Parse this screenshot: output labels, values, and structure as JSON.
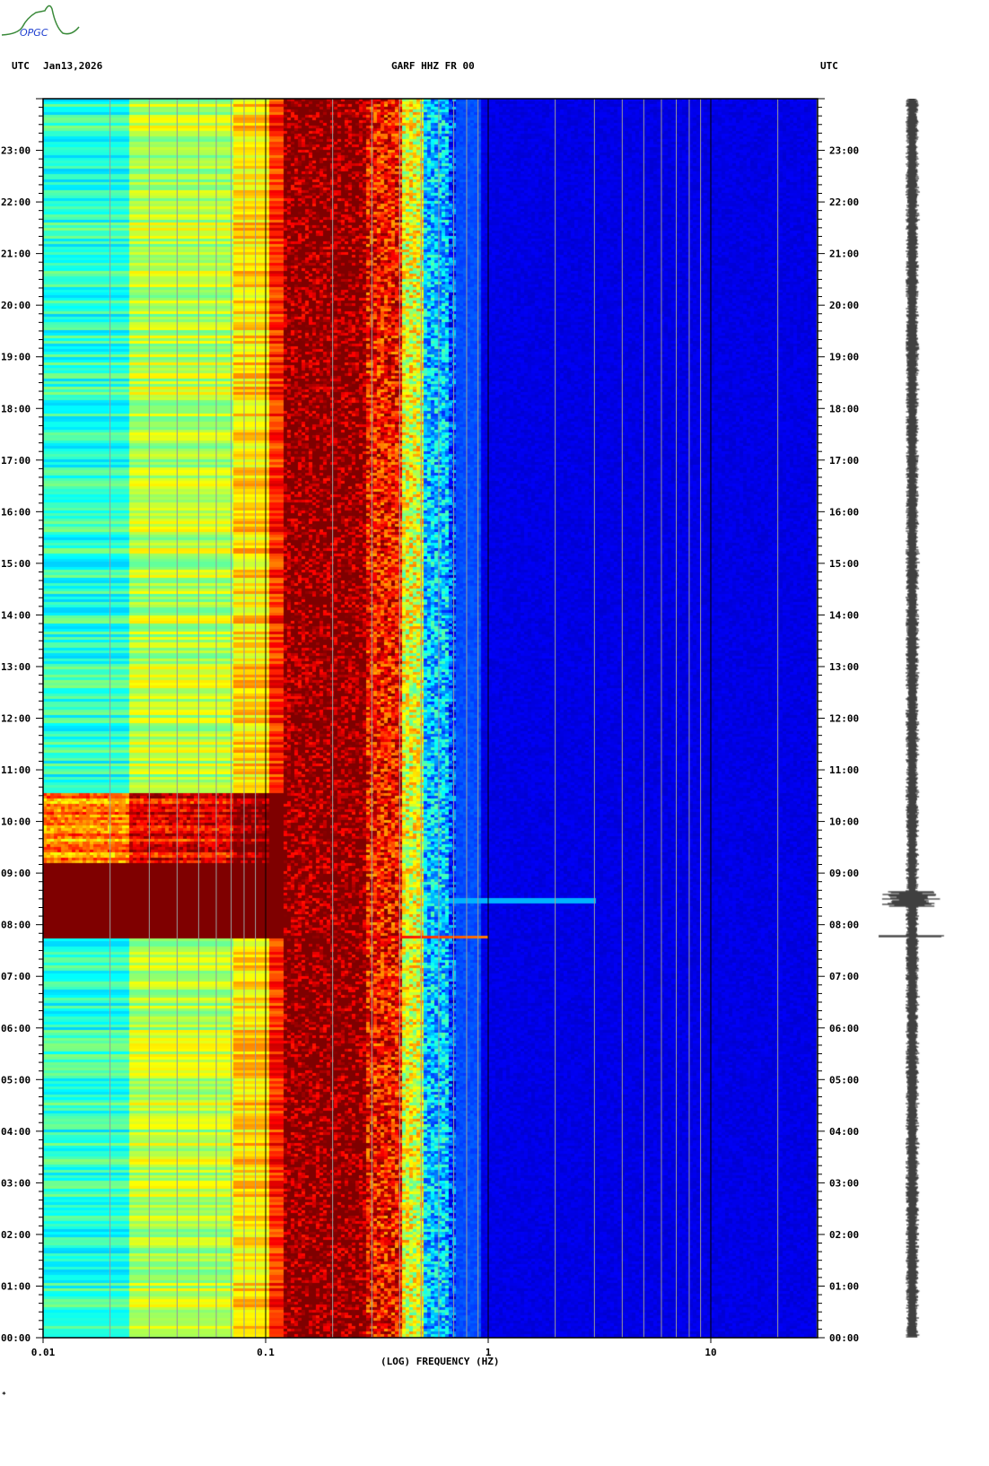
{
  "header": {
    "left_tz": "UTC",
    "date": "Jan13,2026",
    "station": "GARF HHZ FR 00",
    "right_tz": "UTC"
  },
  "logo": {
    "text": "OPGC"
  },
  "footer_mark": "*",
  "chart_data": {
    "type": "heatmap",
    "title": "GARF HHZ FR 00",
    "xlabel": "(LOG) FREQUENCY (HZ)",
    "xscale": "log",
    "xlim": [
      0.01,
      30
    ],
    "x_ticks": [
      "0.01",
      "0.1",
      "1",
      "10"
    ],
    "x_tick_values": [
      0.01,
      0.1,
      1,
      10
    ],
    "ylabel": "UTC",
    "ylim_hours": [
      0,
      24
    ],
    "y_ticks": [
      "00:00",
      "01:00",
      "02:00",
      "03:00",
      "04:00",
      "05:00",
      "06:00",
      "07:00",
      "08:00",
      "09:00",
      "10:00",
      "11:00",
      "12:00",
      "13:00",
      "14:00",
      "15:00",
      "16:00",
      "17:00",
      "18:00",
      "19:00",
      "20:00",
      "21:00",
      "22:00",
      "23:00"
    ],
    "colormap": "jet",
    "spectral_profile": [
      {
        "f_max": 0.024,
        "level": 0.42
      },
      {
        "f_max": 0.07,
        "level": 0.56
      },
      {
        "f_max": 0.1,
        "level": 0.66
      },
      {
        "f_max": 0.12,
        "level": 0.84
      },
      {
        "f_max": 0.28,
        "level": 1.0
      },
      {
        "f_max": 0.4,
        "level": 0.86
      },
      {
        "f_max": 0.5,
        "level": 0.6
      },
      {
        "f_max": 0.65,
        "level": 0.32
      },
      {
        "f_max": 0.9,
        "level": 0.2
      },
      {
        "f_max": 30,
        "level": 0.1
      }
    ],
    "events": [
      {
        "label": "earthquake",
        "start_hour": 7.75,
        "end_hour": 10.6,
        "f_max_hz": 0.12,
        "peak_line_hour": 7.78,
        "peak_line_f_max_hz": 1.0
      }
    ],
    "colors": {
      "low": "#00008f",
      "high": "#800000"
    }
  }
}
